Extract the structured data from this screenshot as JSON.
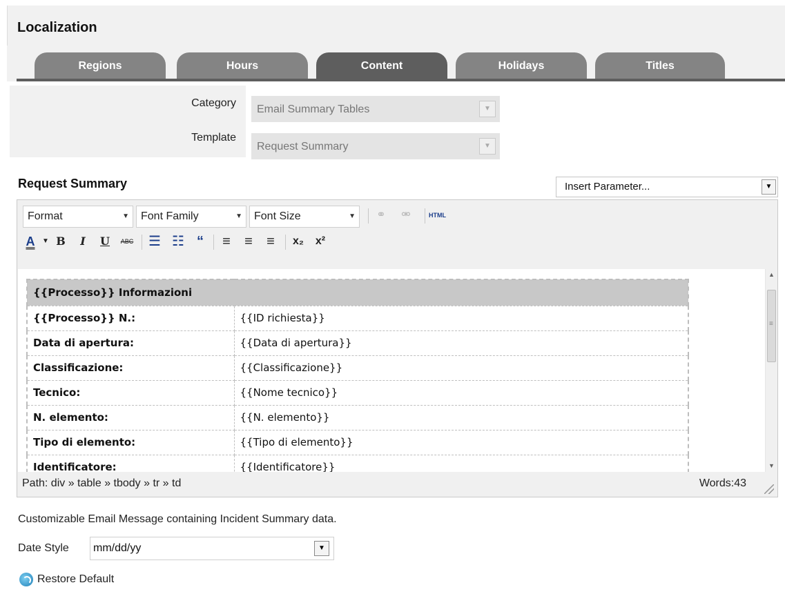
{
  "page": {
    "title": "Localization"
  },
  "tabs": [
    {
      "label": "Regions"
    },
    {
      "label": "Hours"
    },
    {
      "label": "Content"
    },
    {
      "label": "Holidays"
    },
    {
      "label": "Titles"
    }
  ],
  "active_tab": "Content",
  "form": {
    "category_label": "Category",
    "category_value": "Email Summary Tables",
    "template_label": "Template",
    "template_value": "Request Summary"
  },
  "section": {
    "title": "Request Summary",
    "insert_parameter": "Insert Parameter..."
  },
  "toolbar": {
    "format": "Format",
    "font_family": "Font Family",
    "font_size": "Font Size",
    "html": "HTML",
    "icons": [
      "link-icon",
      "unlink-icon",
      "html-icon",
      "font-color-icon",
      "bold-icon",
      "italic-icon",
      "underline-icon",
      "strikethrough-icon",
      "bullet-list-icon",
      "numbered-list-icon",
      "blockquote-icon",
      "align-left-icon",
      "align-center-icon",
      "align-right-icon",
      "subscript-icon",
      "superscript-icon"
    ]
  },
  "editor_table": {
    "header": "{{Processo}} Informazioni",
    "rows": [
      {
        "label": "{{Processo}} N.:",
        "value": "{{ID richiesta}}"
      },
      {
        "label": "Data di apertura:",
        "value": "{{Data di apertura}}"
      },
      {
        "label": "Classificazione:",
        "value": "{{Classificazione}}"
      },
      {
        "label": "Tecnico:",
        "value": "{{Nome tecnico}}"
      },
      {
        "label": "N. elemento:",
        "value": "{{N. elemento}}"
      },
      {
        "label": "Tipo di elemento:",
        "value": "{{Tipo di elemento}}"
      },
      {
        "label": "Identificatore:",
        "value": "{{Identificatore}}"
      }
    ]
  },
  "status": {
    "path": "Path: div » table » tbody » tr » td",
    "words": "Words:43"
  },
  "description": "Customizable Email Message containing Incident Summary data.",
  "date_style": {
    "label": "Date Style",
    "value": "mm/dd/yy"
  },
  "restore_label": "Restore Default"
}
